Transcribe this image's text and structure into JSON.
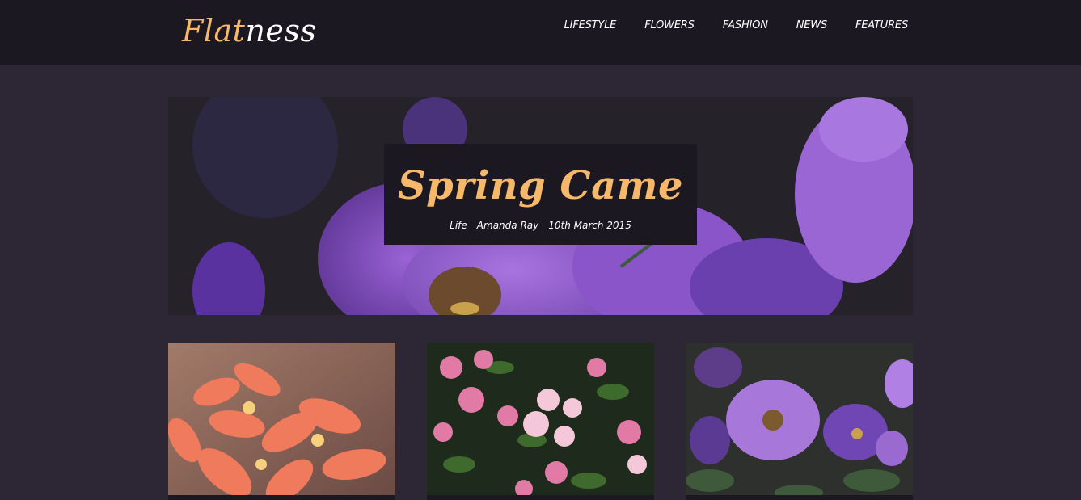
{
  "header": {
    "logo_part1": "Flat",
    "logo_part2": "ness",
    "nav": [
      "LIFESTYLE",
      "FLOWERS",
      "FASHION",
      "NEWS",
      "FEATURES"
    ]
  },
  "hero": {
    "title": "Spring Came",
    "category": "Life",
    "author": "Amanda Ray",
    "date": "10th March 2015",
    "image": "purple-flowers-photo"
  },
  "cards": [
    {
      "image": "orange-lily-flowers-photo",
      "caption": ""
    },
    {
      "image": "pink-blossom-photo",
      "caption": ""
    },
    {
      "image": "purple-petunia-photo",
      "caption": ""
    }
  ],
  "colors": {
    "page_bg": "#2d2635",
    "header_bg": "#1c1822",
    "accent": "#f6b86a",
    "text": "#ffffff"
  }
}
